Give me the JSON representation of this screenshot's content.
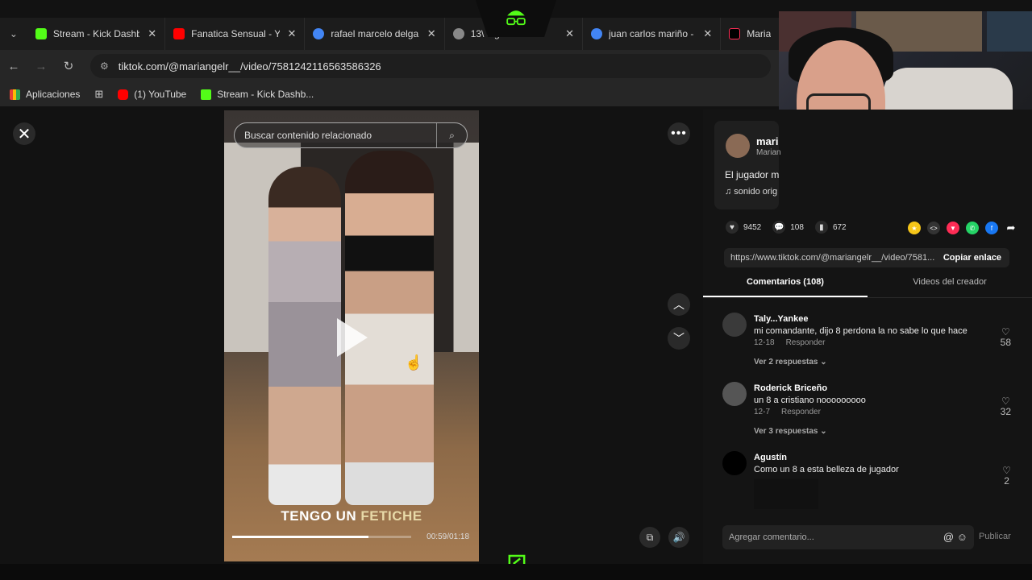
{
  "browser": {
    "tabs": [
      {
        "title": "Stream - Kick Dashbo",
        "favicon_color": "#53fc18"
      },
      {
        "title": "Fanatica Sensual - Yo",
        "favicon_color": "#ff0000"
      },
      {
        "title": "rafael marcelo delga",
        "favicon_color": "#4285f4"
      },
      {
        "title": "13\\ elg",
        "favicon_color": "#888888"
      },
      {
        "title": "juan carlos mariño - I",
        "favicon_color": "#4285f4"
      },
      {
        "title": "Marian",
        "favicon_color": "#000000"
      }
    ],
    "url": "tiktok.com/@mariangelr__/video/7581242116563586326",
    "bookmarks": [
      {
        "label": "Aplicaciones"
      },
      {
        "label": ""
      },
      {
        "label": "(1) YouTube"
      },
      {
        "label": "Stream - Kick Dashb..."
      }
    ]
  },
  "video": {
    "search_placeholder": "Buscar contenido relacionado",
    "caption_a": "TENGO UN ",
    "caption_b": "FETICHE",
    "time": "00:59/01:18",
    "progress": 0.76
  },
  "author": {
    "name": "mari",
    "sub": "Marian",
    "description": "El jugador m",
    "sound": "♫ sonido orig"
  },
  "stats": {
    "likes": "9452",
    "comments": "108",
    "saves": "672"
  },
  "link": {
    "url": "https://www.tiktok.com/@mariangelr__/video/7581...",
    "copy_label": "Copiar enlace"
  },
  "tabs": {
    "comments": "Comentarios (108)",
    "creator_videos": "Videos del creador"
  },
  "comments": [
    {
      "name": "Taly...Yankee",
      "text": "mi comandante, dijo 8 perdona la no sabe lo que hace",
      "date": "12-18",
      "reply": "Responder",
      "replies": "Ver 2 respuestas ⌄",
      "likes": "58"
    },
    {
      "name": "Roderick Briceño",
      "text": "un 8 a cristiano nooooooooo",
      "date": "12-7",
      "reply": "Responder",
      "replies": "Ver 3 respuestas ⌄",
      "likes": "32"
    },
    {
      "name": "Agustín",
      "text": "Como un 8 a esta belleza de jugador",
      "date": "",
      "reply": "",
      "replies": "",
      "likes": "2"
    }
  ],
  "add_comment": {
    "placeholder": "Agregar comentario...",
    "publish": "Publicar"
  },
  "colors": {
    "kick_green": "#53fc18",
    "panel_bg": "#141414"
  }
}
